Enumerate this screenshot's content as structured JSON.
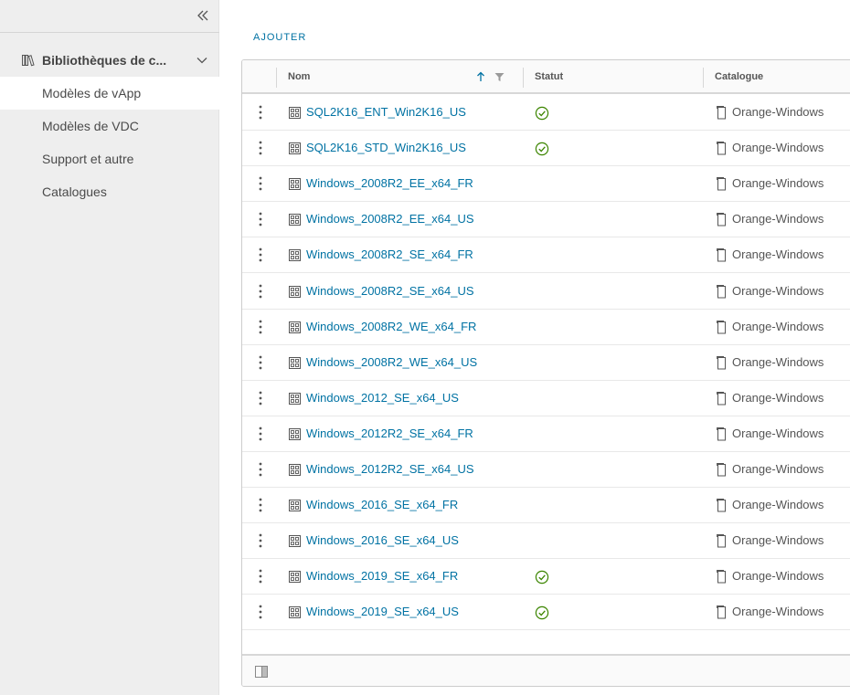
{
  "sidebar": {
    "collapse_icon": "double-chevron-left-icon",
    "group": {
      "label": "Bibliothèques de c...",
      "icon": "library-icon"
    },
    "items": [
      {
        "label": "Modèles de vApp",
        "active": true
      },
      {
        "label": "Modèles de VDC",
        "active": false
      },
      {
        "label": "Support et autre",
        "active": false
      },
      {
        "label": "Catalogues",
        "active": false
      }
    ]
  },
  "toolbar": {
    "add_label": "AJOUTER"
  },
  "grid": {
    "columns": {
      "name": "Nom",
      "status": "Statut",
      "catalog": "Catalogue"
    },
    "rows": [
      {
        "name": "SQL2K16_ENT_Win2K16_US",
        "status_ok": true,
        "catalog": "Orange-Windows"
      },
      {
        "name": "SQL2K16_STD_Win2K16_US",
        "status_ok": true,
        "catalog": "Orange-Windows"
      },
      {
        "name": "Windows_2008R2_EE_x64_FR",
        "status_ok": false,
        "catalog": "Orange-Windows"
      },
      {
        "name": "Windows_2008R2_EE_x64_US",
        "status_ok": false,
        "catalog": "Orange-Windows"
      },
      {
        "name": "Windows_2008R2_SE_x64_FR",
        "status_ok": false,
        "catalog": "Orange-Windows"
      },
      {
        "name": "Windows_2008R2_SE_x64_US",
        "status_ok": false,
        "catalog": "Orange-Windows"
      },
      {
        "name": "Windows_2008R2_WE_x64_FR",
        "status_ok": false,
        "catalog": "Orange-Windows"
      },
      {
        "name": "Windows_2008R2_WE_x64_US",
        "status_ok": false,
        "catalog": "Orange-Windows"
      },
      {
        "name": "Windows_2012_SE_x64_US",
        "status_ok": false,
        "catalog": "Orange-Windows"
      },
      {
        "name": "Windows_2012R2_SE_x64_FR",
        "status_ok": false,
        "catalog": "Orange-Windows"
      },
      {
        "name": "Windows_2012R2_SE_x64_US",
        "status_ok": false,
        "catalog": "Orange-Windows"
      },
      {
        "name": "Windows_2016_SE_x64_FR",
        "status_ok": false,
        "catalog": "Orange-Windows"
      },
      {
        "name": "Windows_2016_SE_x64_US",
        "status_ok": false,
        "catalog": "Orange-Windows"
      },
      {
        "name": "Windows_2019_SE_x64_FR",
        "status_ok": true,
        "catalog": "Orange-Windows"
      },
      {
        "name": "Windows_2019_SE_x64_US",
        "status_ok": true,
        "catalog": "Orange-Windows"
      }
    ]
  },
  "colors": {
    "link": "#0072a3",
    "status_ok": "#3c8500",
    "sidebar_bg": "#eeeeee"
  }
}
